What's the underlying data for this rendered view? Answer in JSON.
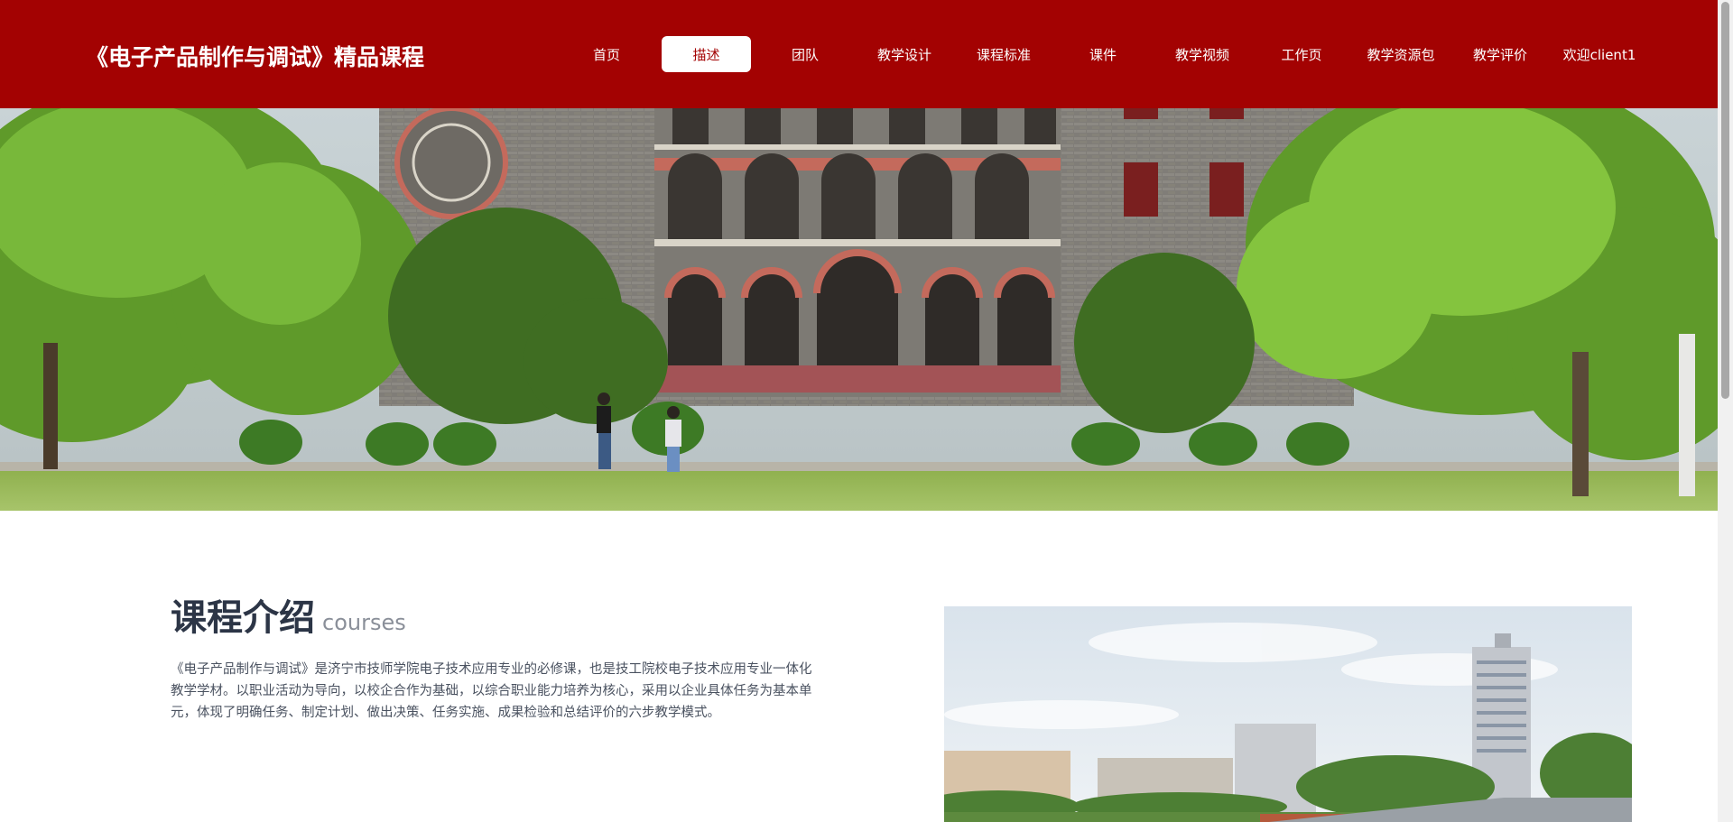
{
  "header": {
    "site_title": "《电子产品制作与调试》精品课程",
    "background": "#a30202"
  },
  "nav": {
    "items": [
      {
        "label": "首页",
        "active": false
      },
      {
        "label": "描述",
        "active": true
      },
      {
        "label": "团队",
        "active": false
      },
      {
        "label": "教学设计",
        "active": false
      },
      {
        "label": "课程标准",
        "active": false
      },
      {
        "label": "课件",
        "active": false
      },
      {
        "label": "教学视频",
        "active": false
      },
      {
        "label": "工作页",
        "active": false
      },
      {
        "label": "教学资源包",
        "active": false
      },
      {
        "label": "教学评价",
        "active": false
      },
      {
        "label": "欢迎client1",
        "active": false
      }
    ]
  },
  "intro": {
    "title": "课程介绍",
    "subtitle": "courses",
    "body": "《电子产品制作与调试》是济宁市技师学院电子技术应用专业的必修课，也是技工院校电子技术应用专业一体化教学学材。以职业活动为导向，以校企合作为基础，以综合职业能力培养为核心，采用以企业具体任务为基本单元，体现了明确任务、制定计划、做出决策、任务实施、成果检验和总结评价的六步教学模式。"
  }
}
